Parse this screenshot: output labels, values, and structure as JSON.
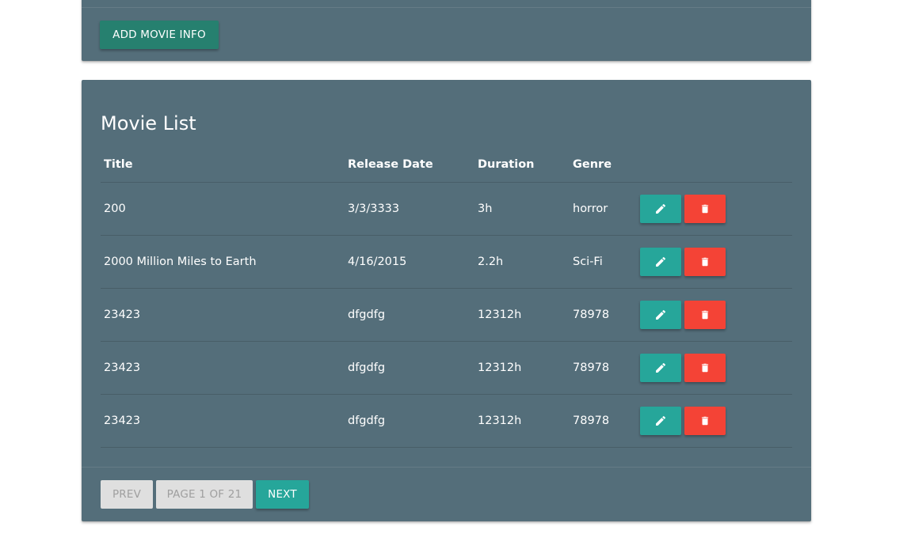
{
  "add_card": {
    "add_button_label": "ADD MOVIE INFO"
  },
  "movie_list": {
    "title": "Movie List",
    "columns": [
      "Title",
      "Release Date",
      "Duration",
      "Genre"
    ],
    "rows": [
      {
        "title": "200",
        "release_date": "3/3/3333",
        "duration": "3h",
        "genre": "horror"
      },
      {
        "title": "2000 Million Miles to Earth",
        "release_date": "4/16/2015",
        "duration": "2.2h",
        "genre": "Sci-Fi"
      },
      {
        "title": "23423",
        "release_date": "dfgdfg",
        "duration": "12312h",
        "genre": "78978"
      },
      {
        "title": "23423",
        "release_date": "dfgdfg",
        "duration": "12312h",
        "genre": "78978"
      },
      {
        "title": "23423",
        "release_date": "dfgdfg",
        "duration": "12312h",
        "genre": "78978"
      }
    ],
    "row_actions": {
      "edit_icon": "pencil-icon",
      "delete_icon": "trash-icon"
    }
  },
  "pagination": {
    "prev_label": "PREV",
    "page_label": "PAGE 1 OF 21",
    "next_label": "NEXT"
  },
  "colors": {
    "card_background": "#546e7a",
    "edit_button": "#26a69a",
    "delete_button": "#f44336",
    "add_button": "#26806f",
    "disabled_button": "#dfdfdf"
  }
}
